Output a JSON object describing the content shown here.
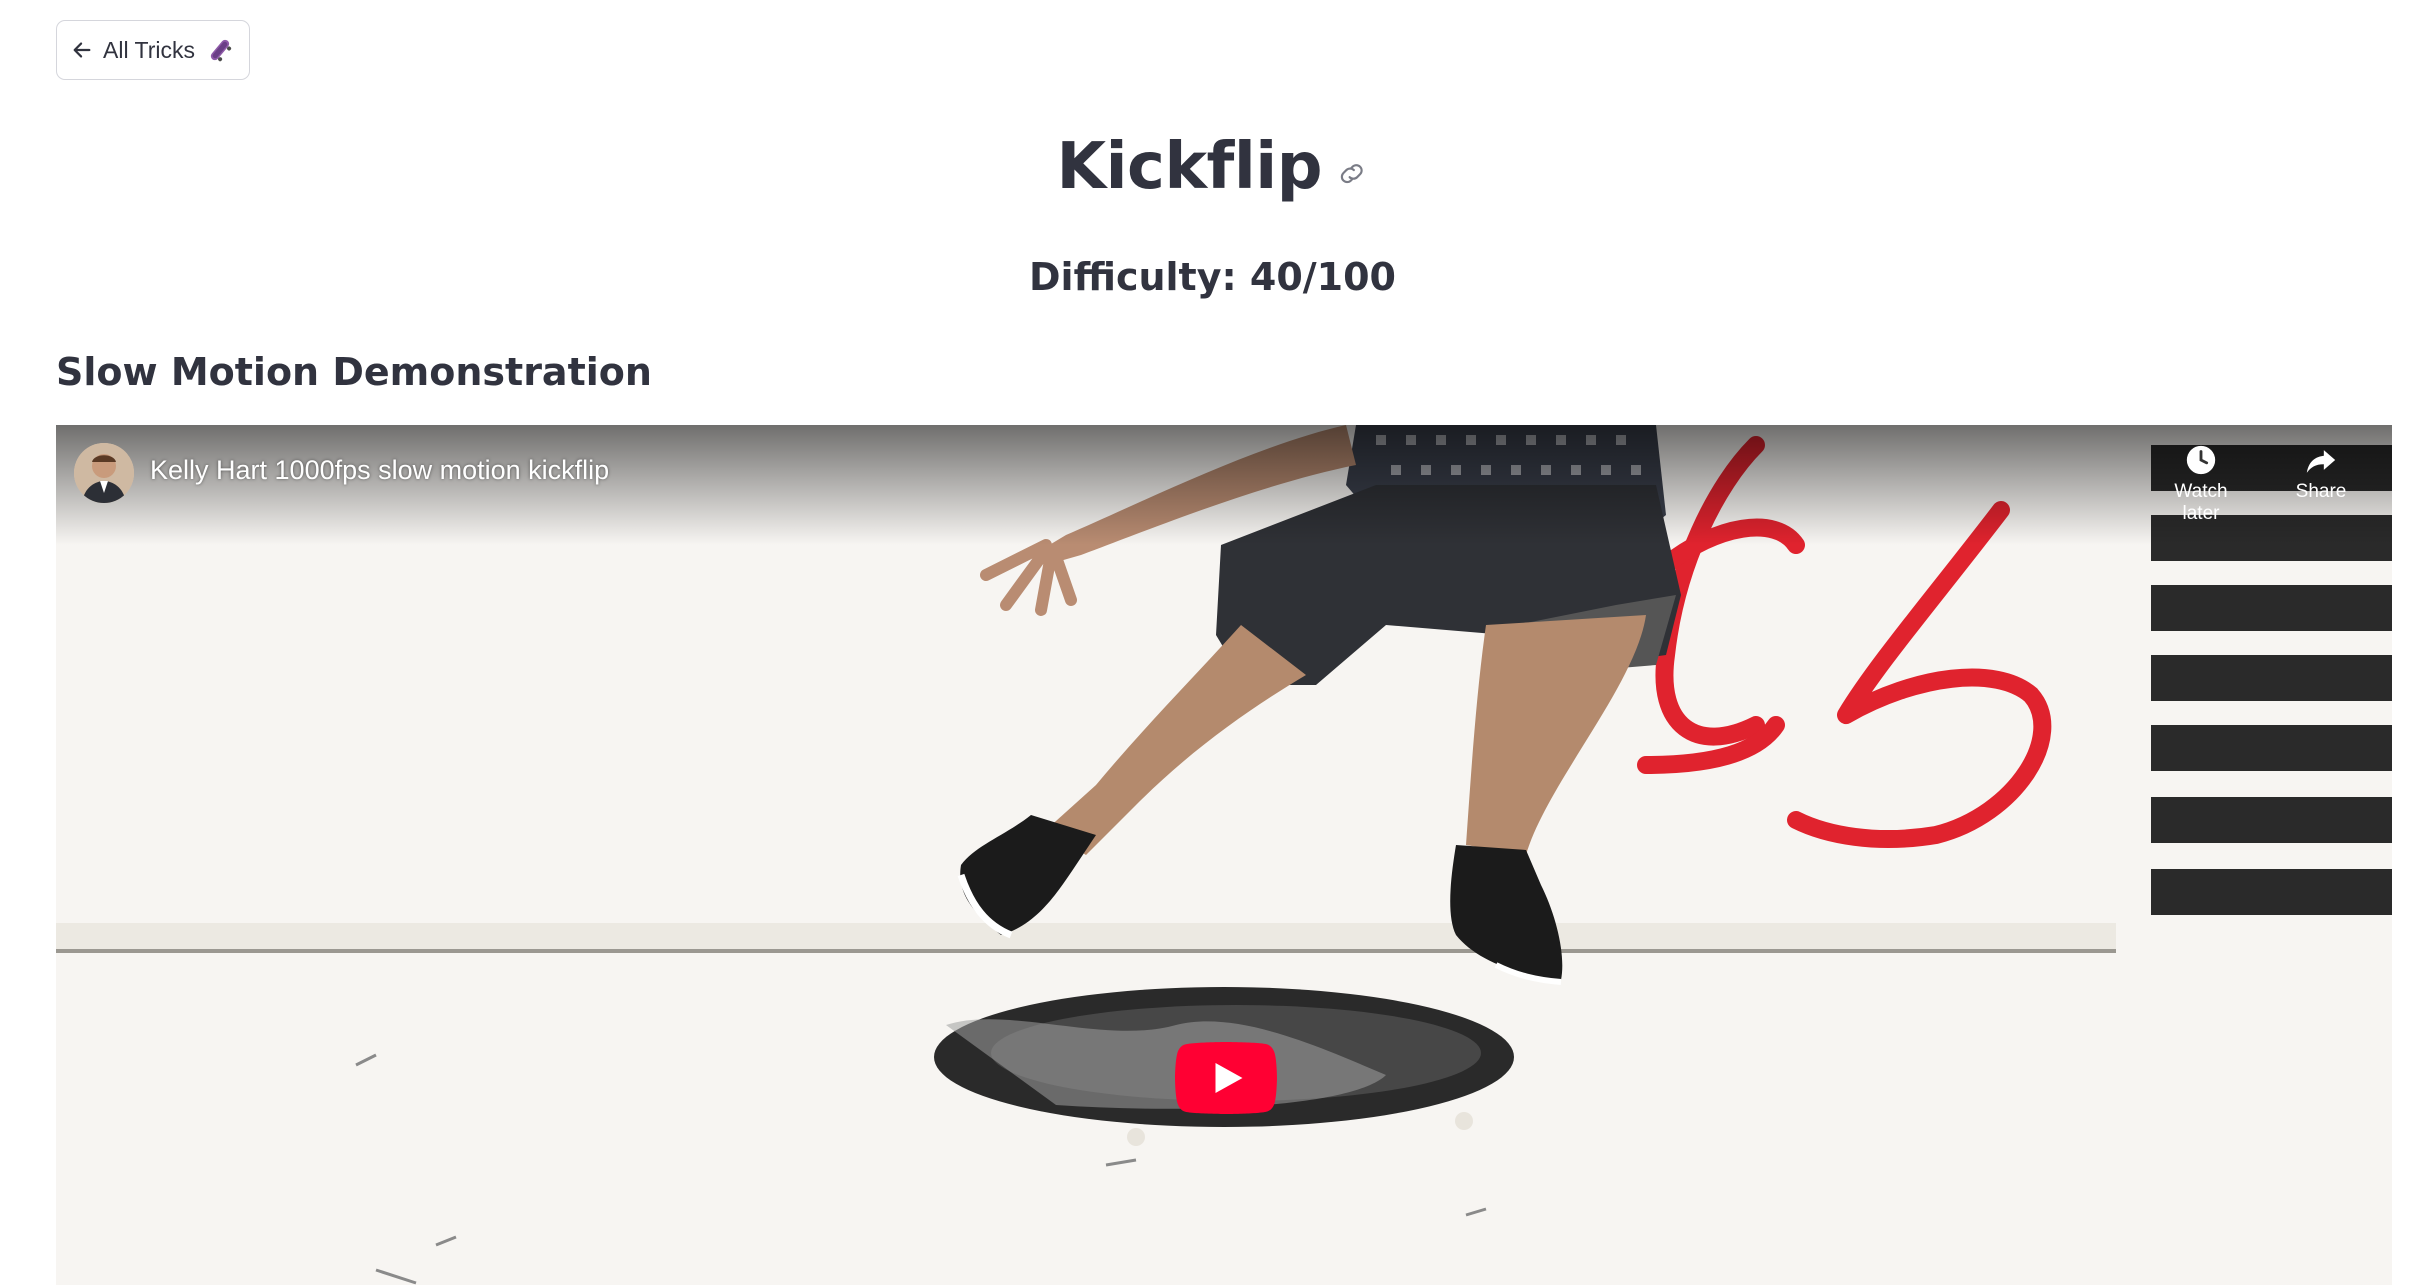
{
  "nav": {
    "back_label": "All Tricks",
    "back_icon": "arrow-left-icon",
    "back_emoji": "skateboard-icon"
  },
  "header": {
    "title": "Kickflip",
    "anchor_icon": "link-icon"
  },
  "difficulty": {
    "text": "Difficulty: 40/100"
  },
  "section": {
    "heading": "Slow Motion Demonstration"
  },
  "video": {
    "title": "Kelly Hart 1000fps slow motion kickflip",
    "watch_later_label": "Watch later",
    "share_label": "Share",
    "play_color": "#ff0033"
  },
  "colors": {
    "text": "#31333f",
    "border": "#d5d6dc",
    "graffiti_red": "#e0232e"
  }
}
